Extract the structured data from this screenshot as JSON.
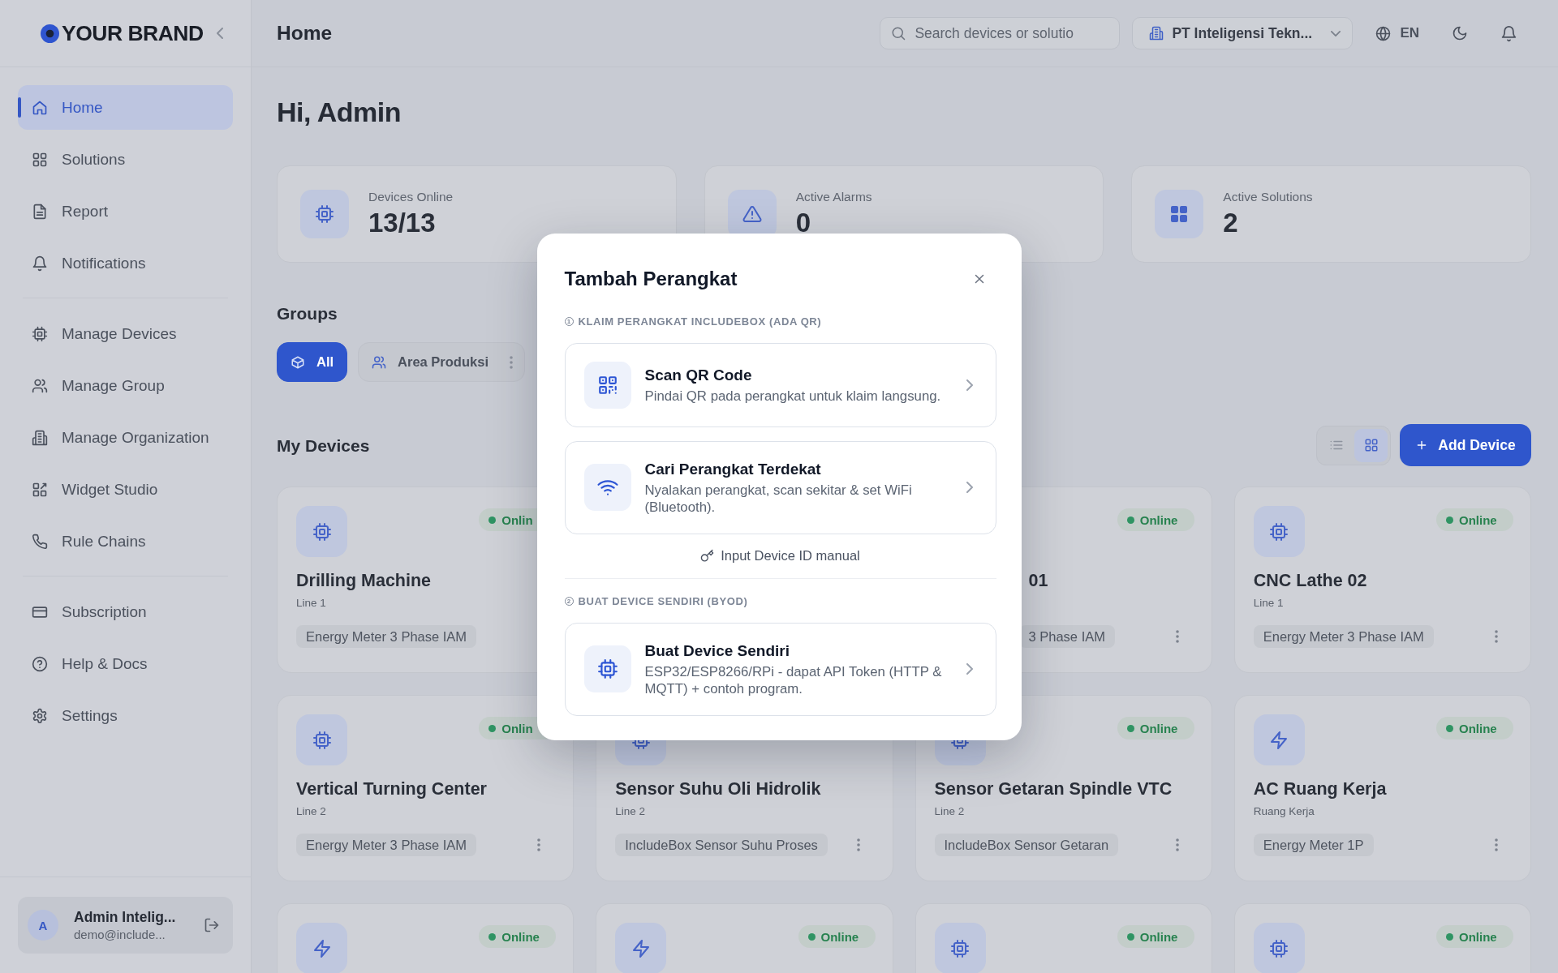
{
  "sidebar": {
    "brand": "YOUR BRAND",
    "sections": [
      {
        "items": [
          {
            "label": "Home",
            "selected": true
          },
          {
            "label": "Solutions",
            "selected": false
          },
          {
            "label": "Report",
            "selected": false
          },
          {
            "label": "Notifications",
            "selected": false
          }
        ]
      },
      {
        "items": [
          {
            "label": "Manage Devices",
            "selected": false
          },
          {
            "label": "Manage Group",
            "selected": false
          },
          {
            "label": "Manage Organization",
            "selected": false
          },
          {
            "label": "Widget Studio",
            "selected": false
          },
          {
            "label": "Rule Chains",
            "selected": false
          }
        ]
      },
      {
        "items": [
          {
            "label": "Subscription",
            "selected": false
          },
          {
            "label": "Help & Docs",
            "selected": false
          },
          {
            "label": "Settings",
            "selected": false
          }
        ]
      }
    ],
    "user": {
      "avatar": "A",
      "name": "Admin Intelig...",
      "email": "demo@include..."
    }
  },
  "header": {
    "title": "Home",
    "search": {
      "placeholder": "Search devices or solutio"
    },
    "organization": "PT Inteligensi Tekn...",
    "language": "EN"
  },
  "greeting": "Hi, Admin",
  "stats": [
    {
      "label": "Devices Online",
      "value": "13/13"
    },
    {
      "label": "Active Alarms",
      "value": "0"
    },
    {
      "label": "Active Solutions",
      "value": "2"
    }
  ],
  "groups": {
    "title": "Groups",
    "chips": [
      {
        "kind": "all",
        "label": "All",
        "selected": true
      },
      {
        "kind": "group",
        "label": "Area Produksi",
        "selected": false
      }
    ]
  },
  "devices": {
    "title": "My Devices",
    "views": [
      {
        "kind": "list",
        "selected": false
      },
      {
        "kind": "grid",
        "selected": true
      }
    ],
    "add_button": "Add Device",
    "cards": [
      {
        "kind": "device",
        "name": "Drilling Machine",
        "line": "Line 1",
        "tag": "Energy Meter 3 Phase IAM",
        "status": "Onlin",
        "left_hidden": false
      },
      {
        "name": "01",
        "tag": "3 Phase IAM",
        "status": "Online",
        "left_hidden": true
      },
      {
        "kind": "device",
        "name": "CNC Lathe 02",
        "line": "Line 1",
        "tag": "Energy Meter 3 Phase IAM",
        "status": "Online",
        "left_hidden": false
      },
      {
        "kind": "device",
        "name": "Vertical Turning Center",
        "line": "Line 2",
        "tag": "Energy Meter 3 Phase IAM",
        "status": "Onlin",
        "left_hidden": false
      },
      {
        "kind": "device",
        "name": "Sensor Suhu Oli Hidrolik",
        "line": "Line 2",
        "tag": "IncludeBox Sensor Suhu Proses",
        "left_hidden": false
      },
      {
        "kind": "device",
        "name": "Sensor Getaran Spindle VTC",
        "line": "Line 2",
        "tag": "IncludeBox Sensor Getaran",
        "status": "Online",
        "left_hidden": false
      },
      {
        "kind": "energy",
        "name": "AC Ruang Kerja",
        "line": "Ruang Kerja",
        "tag": "Energy Meter 1P",
        "status": "Online",
        "left_hidden": false
      },
      {
        "kind": "energy",
        "status": "Online",
        "left_hidden": false
      },
      {
        "kind": "energy",
        "status": "Online",
        "left_hidden": false
      },
      {
        "kind": "device",
        "status": "Online",
        "left_hidden": false
      },
      {
        "kind": "device",
        "status": "Online",
        "left_hidden": false
      }
    ]
  },
  "dialog": {
    "title": "Tambah Perangkat",
    "sections": [
      {
        "step": "1",
        "label": "KLAIM PERANGKAT INCLUDEBOX (ADA QR)",
        "options": [
          {
            "kind": "scan",
            "title": "Scan QR Code",
            "description": "Pindai QR pada perangkat untuk klaim langsung."
          },
          {
            "kind": "nearby",
            "title": "Cari Perangkat Terdekat",
            "description": "Nyalakan perangkat, scan sekitar & set WiFi (Bluetooth)."
          }
        ],
        "link": "Input Device ID manual"
      },
      {
        "step": "2",
        "label": "BUAT DEVICE SENDIRI (BYOD)",
        "options": [
          {
            "kind": "custom",
            "title": "Buat Device Sendiri",
            "description": "ESP32/ESP8266/RPi - dapat API Token (HTTP & MQTT) + contoh program."
          }
        ]
      }
    ]
  }
}
